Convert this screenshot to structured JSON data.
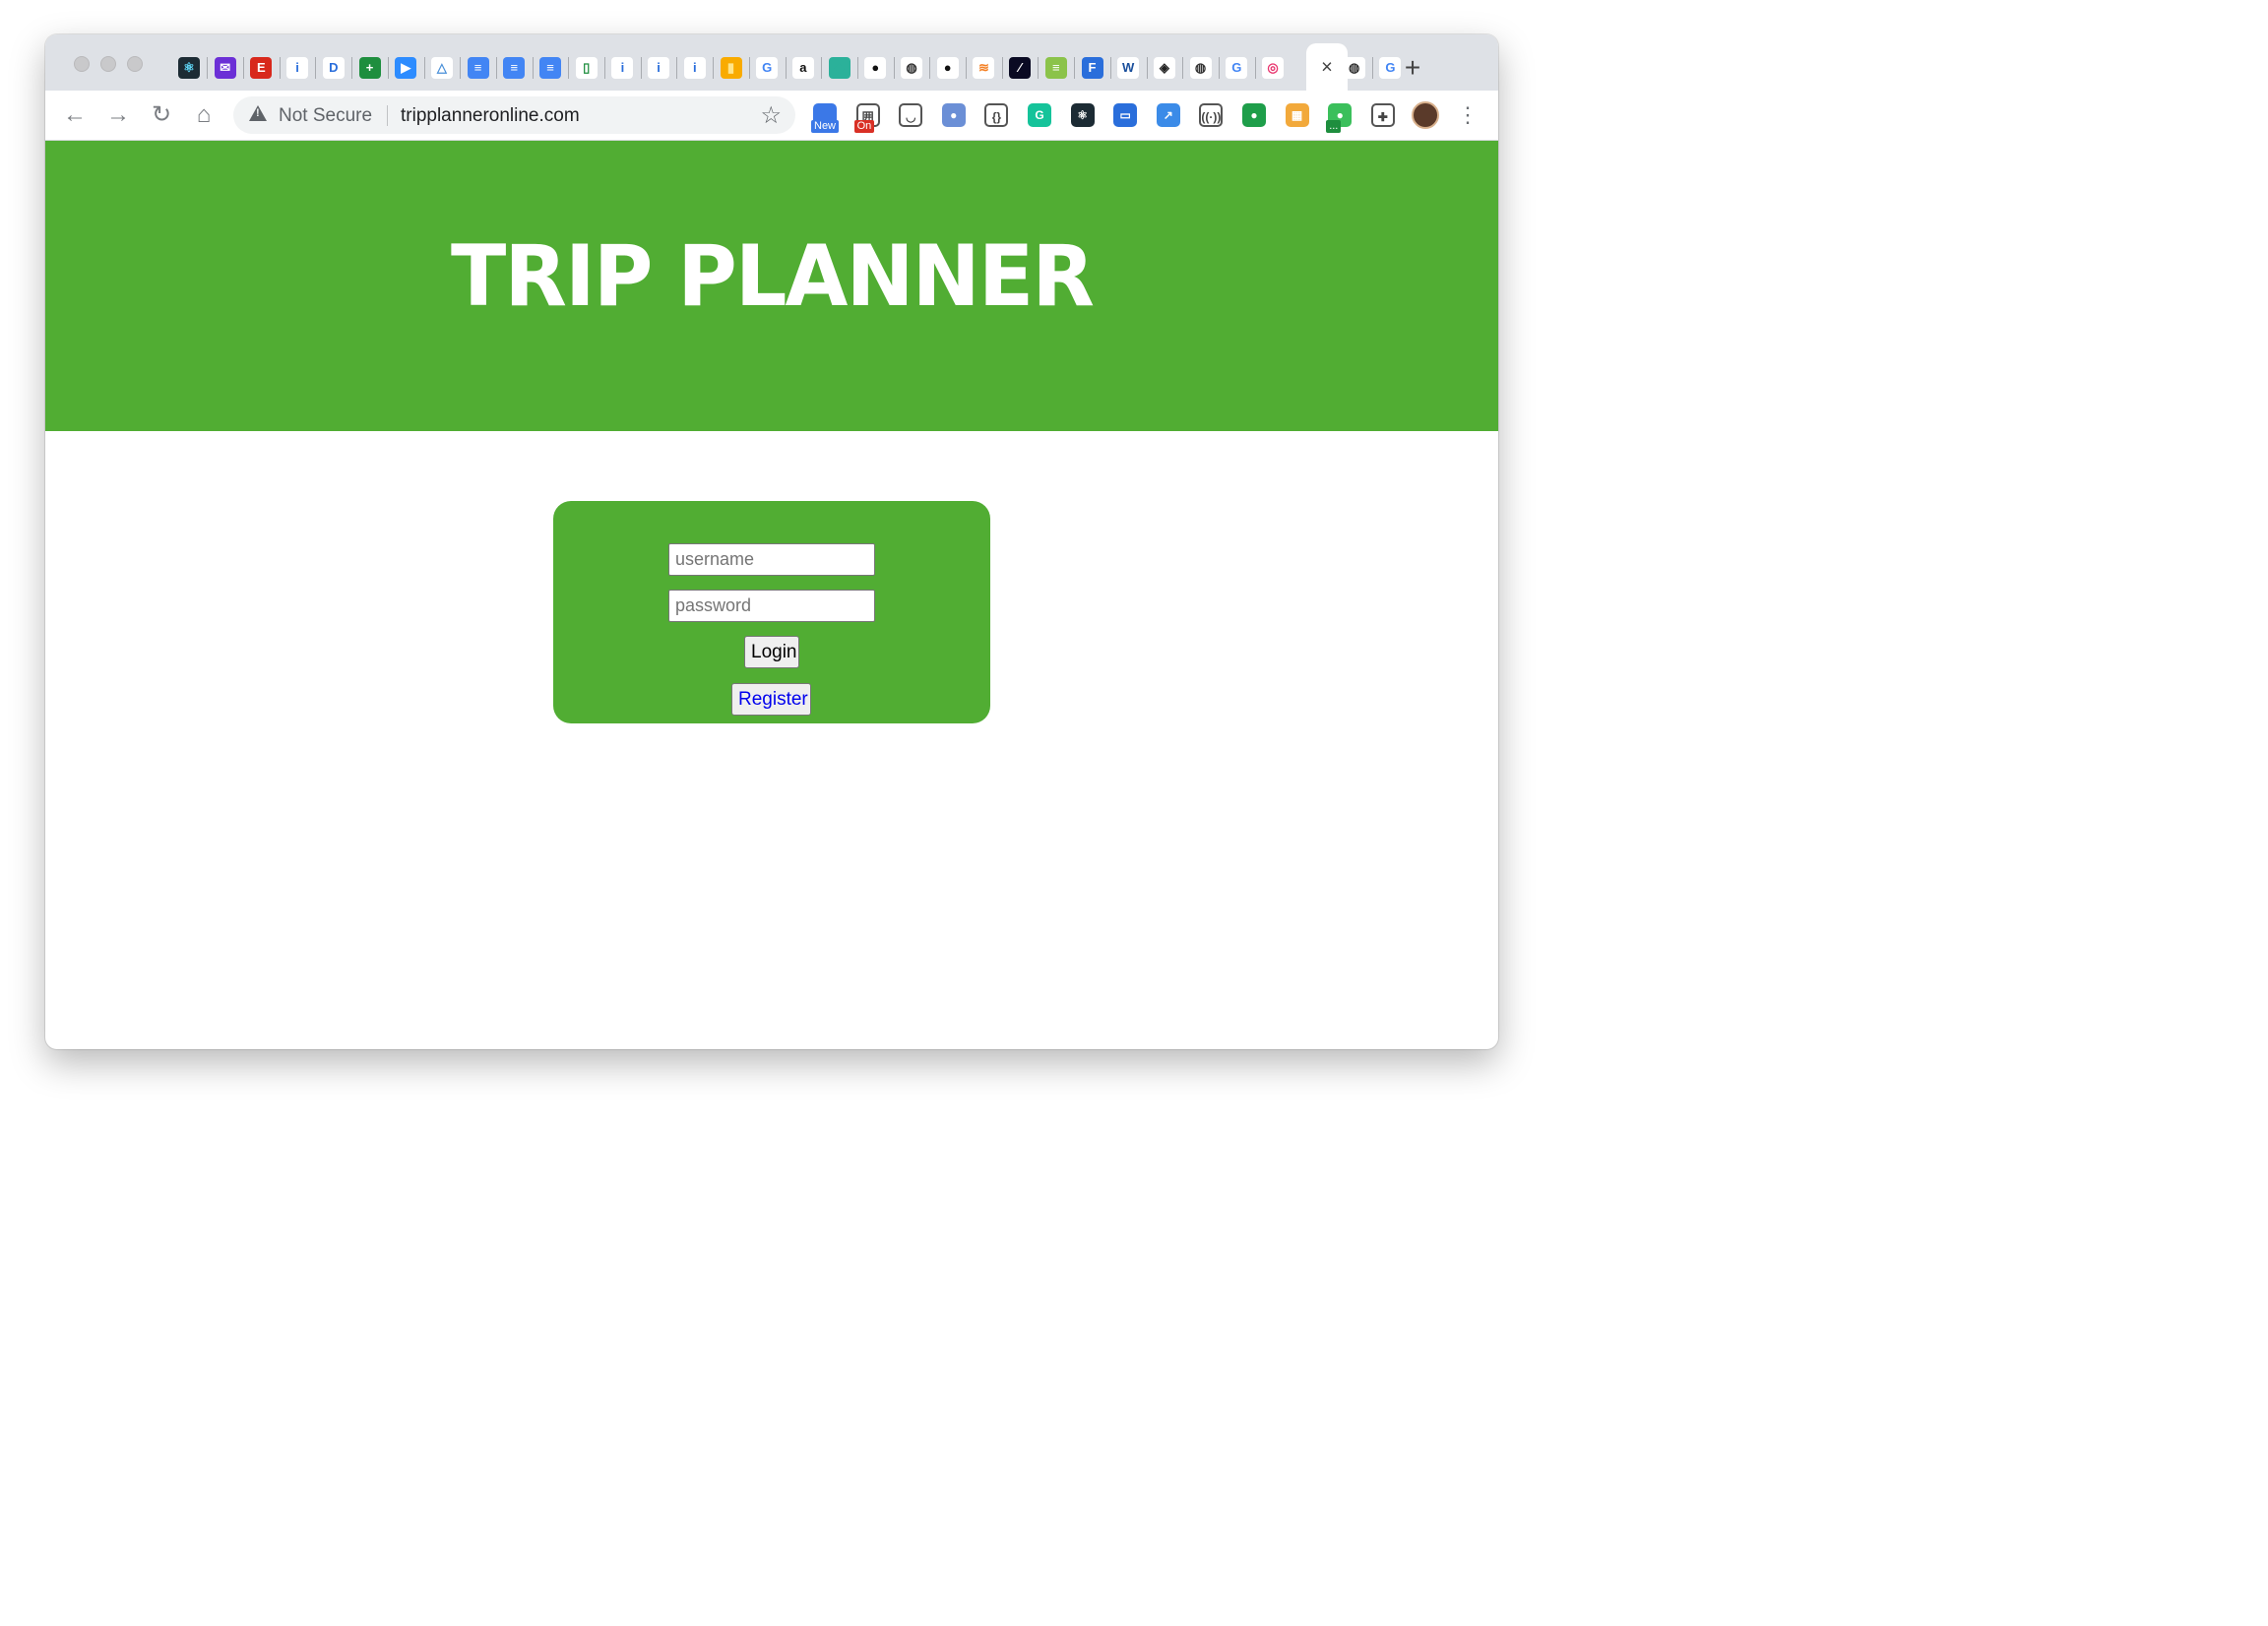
{
  "browser": {
    "address_bar": {
      "security_label": "Not Secure",
      "url": "tripplanneronline.com"
    },
    "active_tab_close": "×",
    "new_tab": "+",
    "tab_favicons": [
      {
        "icon": "react-icon",
        "color": "#1c2b34",
        "glyph": "⚛",
        "fg": "#61dafb"
      },
      {
        "icon": "mail-icon",
        "color": "#6b2fd6",
        "glyph": "✉",
        "fg": "#ffffff"
      },
      {
        "icon": "e-icon",
        "color": "#d8281c",
        "glyph": "E",
        "fg": "#ffffff"
      },
      {
        "icon": "info-icon",
        "color": "#ffffff",
        "glyph": "i",
        "fg": "#2a6edb"
      },
      {
        "icon": "d-icon",
        "color": "#ffffff",
        "glyph": "D",
        "fg": "#2a6edb"
      },
      {
        "icon": "sheets-plus-icon",
        "color": "#1e8e3e",
        "glyph": "+",
        "fg": "#ffffff"
      },
      {
        "icon": "zoom-icon",
        "color": "#2d8cff",
        "glyph": "▶",
        "fg": "#ffffff"
      },
      {
        "icon": "drive-icon",
        "color": "#ffffff",
        "glyph": "△",
        "fg": "#4a90d9"
      },
      {
        "icon": "docs-icon",
        "color": "#4285f4",
        "glyph": "≡",
        "fg": "#ffffff"
      },
      {
        "icon": "docs-icon",
        "color": "#4285f4",
        "glyph": "≡",
        "fg": "#ffffff"
      },
      {
        "icon": "docs-icon",
        "color": "#4285f4",
        "glyph": "≡",
        "fg": "#ffffff"
      },
      {
        "icon": "phone-icon",
        "color": "#ffffff",
        "glyph": "▯",
        "fg": "#1e8e3e"
      },
      {
        "icon": "info-icon",
        "color": "#ffffff",
        "glyph": "i",
        "fg": "#2a6edb"
      },
      {
        "icon": "info-icon",
        "color": "#ffffff",
        "glyph": "i",
        "fg": "#2a6edb"
      },
      {
        "icon": "info-icon",
        "color": "#ffffff",
        "glyph": "i",
        "fg": "#2a6edb"
      },
      {
        "icon": "analytics-icon",
        "color": "#f9ab00",
        "glyph": "▮",
        "fg": "#ffe58a"
      },
      {
        "icon": "google-icon",
        "color": "#ffffff",
        "glyph": "G",
        "fg": "#4285f4"
      },
      {
        "icon": "amazon-icon",
        "color": "#ffffff",
        "glyph": "a",
        "fg": "#111111"
      },
      {
        "icon": "diamond-icon",
        "color": "#2bb19a",
        "glyph": "◆",
        "fg": "#2bb19a"
      },
      {
        "icon": "github-icon",
        "color": "#ffffff",
        "glyph": "●",
        "fg": "#111111"
      },
      {
        "icon": "globe-icon",
        "color": "#ffffff",
        "glyph": "◍",
        "fg": "#333333"
      },
      {
        "icon": "github-icon",
        "color": "#ffffff",
        "glyph": "●",
        "fg": "#111111"
      },
      {
        "icon": "stackoverflow-icon",
        "color": "#ffffff",
        "glyph": "≋",
        "fg": "#f48024"
      },
      {
        "icon": "dev-icon",
        "color": "#0a0a23",
        "glyph": "⁄",
        "fg": "#ffffff"
      },
      {
        "icon": "w3-badge-icon",
        "color": "#8bc34a",
        "glyph": "≡",
        "fg": "#ffffff"
      },
      {
        "icon": "f-icon",
        "color": "#2a6edb",
        "glyph": "F",
        "fg": "#ffffff"
      },
      {
        "icon": "w3-icon",
        "color": "#ffffff",
        "glyph": "W",
        "fg": "#1a4f9c"
      },
      {
        "icon": "cube-icon",
        "color": "#ffffff",
        "glyph": "◈",
        "fg": "#222222"
      },
      {
        "icon": "globe-icon",
        "color": "#ffffff",
        "glyph": "◍",
        "fg": "#333333"
      },
      {
        "icon": "google-icon",
        "color": "#ffffff",
        "glyph": "G",
        "fg": "#4285f4"
      },
      {
        "icon": "spiral-icon",
        "color": "#ffffff",
        "glyph": "◎",
        "fg": "#e8336d"
      },
      {
        "icon": "globe-icon",
        "color": "#ffffff",
        "glyph": "◍",
        "fg": "#333333"
      },
      {
        "icon": "google-icon",
        "color": "#ffffff",
        "glyph": "G",
        "fg": "#4285f4"
      }
    ],
    "extensions": [
      {
        "icon": "new-badge-extension-icon",
        "color": "#3b78e7",
        "glyph": "",
        "badge": "New",
        "badge_color": "#3b78e7"
      },
      {
        "icon": "calendar-extension-icon",
        "color": "#ffffff",
        "glyph": "囲",
        "badge": "On",
        "badge_color": "#d93025"
      },
      {
        "icon": "pocket-icon",
        "color": "#ffffff",
        "glyph": "◡",
        "badge": "",
        "badge_color": ""
      },
      {
        "icon": "blob-extension-icon",
        "color": "#6b8fd6",
        "glyph": "●",
        "badge": "",
        "badge_color": ""
      },
      {
        "icon": "code-braces-icon",
        "color": "#ffffff",
        "glyph": "{}",
        "badge": "",
        "badge_color": ""
      },
      {
        "icon": "grammarly-icon",
        "color": "#15c39a",
        "glyph": "G",
        "badge": "",
        "badge_color": ""
      },
      {
        "icon": "react-devtools-icon",
        "color": "#1c2b34",
        "glyph": "⚛",
        "badge": "",
        "badge_color": ""
      },
      {
        "icon": "card-extension-icon",
        "color": "#2a6edb",
        "glyph": "▭",
        "badge": "",
        "badge_color": ""
      },
      {
        "icon": "resize-extension-icon",
        "color": "#3b8be8",
        "glyph": "↗",
        "badge": "",
        "badge_color": ""
      },
      {
        "icon": "broadcast-icon",
        "color": "#ffffff",
        "glyph": "((·))",
        "badge": "",
        "badge_color": ""
      },
      {
        "icon": "speech-bubble-icon",
        "color": "#1e9e4a",
        "glyph": "●",
        "badge": "",
        "badge_color": ""
      },
      {
        "icon": "color-palette-icon",
        "color": "#f2a93b",
        "glyph": "▦",
        "badge": "",
        "badge_color": ""
      },
      {
        "icon": "chat-extension-icon",
        "color": "#3bbf5b",
        "glyph": "●",
        "badge": "...",
        "badge_color": "#1e8e3e"
      },
      {
        "icon": "puzzle-icon",
        "color": "#ffffff",
        "glyph": "✚",
        "badge": "",
        "badge_color": ""
      }
    ]
  },
  "page": {
    "title": "TRIP PLANNER",
    "accent_color": "#51ad33",
    "login": {
      "username_placeholder": "username",
      "password_placeholder": "password",
      "login_label": "Login",
      "register_label": "Register"
    }
  }
}
